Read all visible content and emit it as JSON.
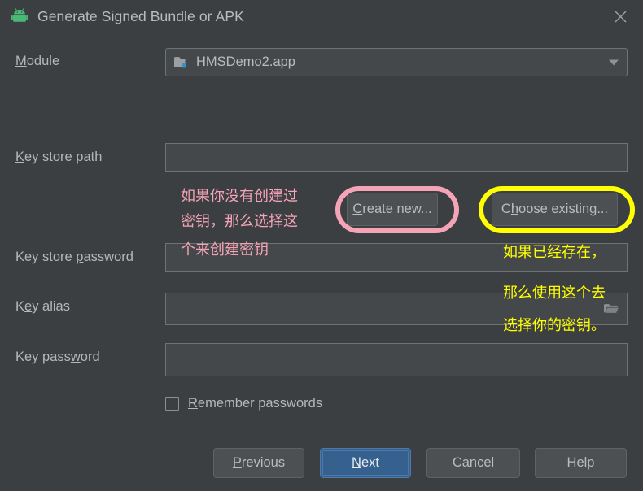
{
  "window": {
    "title": "Generate Signed Bundle or APK",
    "app_icon": "android-robot-icon",
    "close_icon": "close-icon"
  },
  "form": {
    "module": {
      "label": "Module",
      "label_mnemonic": "M",
      "value": "HMSDemo2.app",
      "icon": "module-folder-icon",
      "dropdown_icon": "chevron-down-icon"
    },
    "key_store_path": {
      "label_pre": "",
      "label_mnemonic": "K",
      "label_post": "ey store path",
      "value": ""
    },
    "key_store_password": {
      "label_pre": "Key store ",
      "label_mnemonic": "p",
      "label_post": "assword",
      "value": ""
    },
    "key_alias": {
      "label_pre": "K",
      "label_mnemonic": "e",
      "label_post": "y alias",
      "value": "",
      "browse_icon": "folder-browse-icon"
    },
    "key_password": {
      "label_pre": "Key pass",
      "label_mnemonic": "w",
      "label_post": "ord",
      "value": ""
    },
    "create_new": {
      "pre": "",
      "mnemonic": "C",
      "post": "reate new..."
    },
    "choose_existing": {
      "pre": "C",
      "mnemonic": "h",
      "post": "oose existing..."
    },
    "remember_passwords": {
      "pre": "",
      "mnemonic": "R",
      "post": "emember passwords",
      "checked": false
    }
  },
  "footer": {
    "previous": {
      "pre": "",
      "mnemonic": "P",
      "post": "revious"
    },
    "next": {
      "pre": "",
      "mnemonic": "N",
      "post": "ext"
    },
    "cancel": {
      "label": "Cancel"
    },
    "help": {
      "label": "Help"
    }
  },
  "annotations": {
    "pink": {
      "color": "#f5a3b6",
      "line1": "如果你没有创建过",
      "line2": "密钥，那么选择这",
      "line3": "个来创建密钥",
      "highlight_target": "create-new-button"
    },
    "yellow": {
      "color": "#ffff00",
      "line1": "如果已经存在，",
      "line2": "那么使用这个去",
      "line3": "选择你的密钥。",
      "highlight_target": "choose-existing-button"
    }
  },
  "colors": {
    "background": "#3c3f41",
    "field_background": "#45484a",
    "field_border": "#6e7375",
    "text": "#b4b7b8",
    "primary_button": "#36618e",
    "android_green": "#3ddc84"
  }
}
